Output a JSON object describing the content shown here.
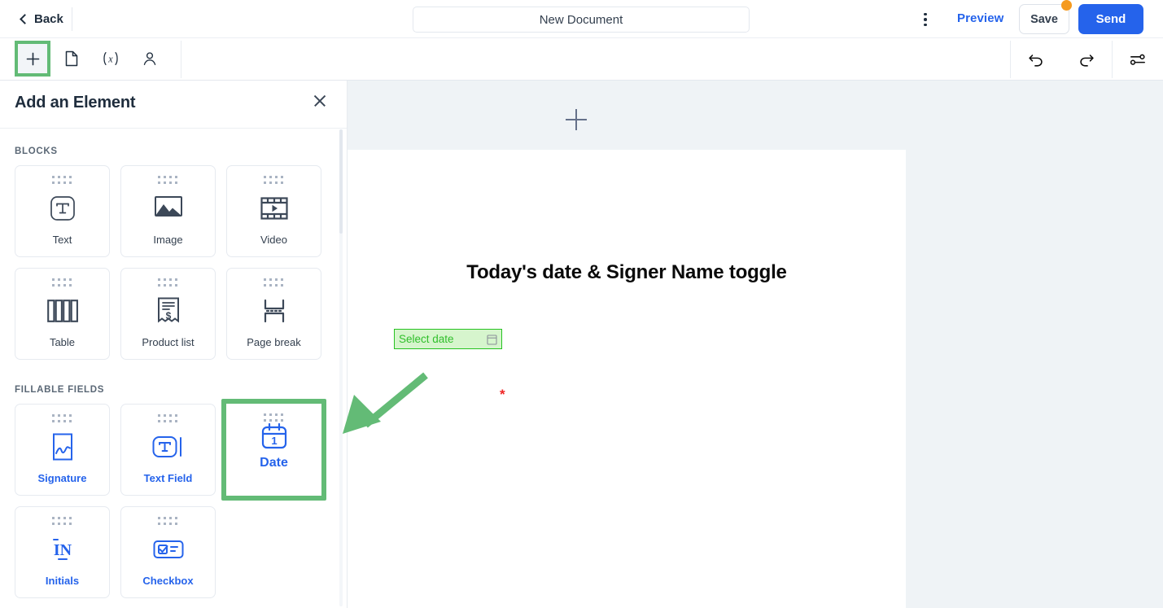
{
  "topbar": {
    "back_label": "Back",
    "doc_title_value": "New Document",
    "doc_title_placeholder": "Document name",
    "kebab_icon": "vertical-ellipsis-icon",
    "preview_label": "Preview",
    "save_label": "Save",
    "save_badge": "unsaved-changes-dot",
    "send_label": "Send"
  },
  "toolbar": {
    "left_tools": [
      {
        "name": "add-element-tool",
        "icon": "plus-icon",
        "active": true
      },
      {
        "name": "pages-tool",
        "icon": "document-page-icon",
        "active": false
      },
      {
        "name": "variables-tool",
        "icon": "variable-x-icon",
        "active": false
      },
      {
        "name": "recipients-tool",
        "icon": "person-icon",
        "active": false
      }
    ],
    "right_tools": [
      {
        "name": "undo-button",
        "icon": "undo-arrow-icon"
      },
      {
        "name": "redo-button",
        "icon": "redo-arrow-icon"
      },
      {
        "name": "settings-button",
        "icon": "sliders-icon"
      }
    ]
  },
  "sidebar": {
    "title": "Add an Element",
    "close_icon": "close-icon",
    "sections": [
      {
        "label": "BLOCKS",
        "items": [
          {
            "label": "Text",
            "icon": "text-block-icon",
            "style": "dark",
            "selected": false
          },
          {
            "label": "Image",
            "icon": "image-icon",
            "style": "dark",
            "selected": false
          },
          {
            "label": "Video",
            "icon": "video-icon",
            "style": "dark",
            "selected": false
          },
          {
            "label": "Table",
            "icon": "table-icon",
            "style": "dark",
            "selected": false
          },
          {
            "label": "Product list",
            "icon": "product-list-icon",
            "style": "dark",
            "selected": false
          },
          {
            "label": "Page break",
            "icon": "page-break-icon",
            "style": "dark",
            "selected": false
          }
        ]
      },
      {
        "label": "FILLABLE FIELDS",
        "items": [
          {
            "label": "Signature",
            "icon": "signature-icon",
            "style": "blue",
            "selected": false
          },
          {
            "label": "Text Field",
            "icon": "text-field-icon",
            "style": "blue",
            "selected": false
          },
          {
            "label": "Date",
            "icon": "calendar-date-icon",
            "style": "blue",
            "selected": true
          },
          {
            "label": "Initials",
            "icon": "initials-icon",
            "style": "blue",
            "selected": false
          },
          {
            "label": "Checkbox",
            "icon": "checkbox-icon",
            "style": "blue",
            "selected": false
          }
        ]
      }
    ]
  },
  "canvas": {
    "add_block_icon": "plus-icon",
    "page_menu_icon": "horizontal-ellipsis-icon",
    "page": {
      "heading": "Today's date & Signer Name toggle",
      "date_field": {
        "placeholder": "Select date",
        "icon": "calendar-icon",
        "required_marker": "*"
      }
    }
  },
  "annotation": {
    "arrow": "green-pointer-arrow",
    "highlight_color": "#63bb76"
  },
  "colors": {
    "accent_blue": "#2563eb",
    "highlight_green": "#63bb76",
    "field_green_border": "#27c221",
    "field_green_fill": "#d6f5cd",
    "badge_orange": "#f59a1f",
    "required_red": "#ef2424",
    "canvas_bg": "#eff3f6"
  }
}
